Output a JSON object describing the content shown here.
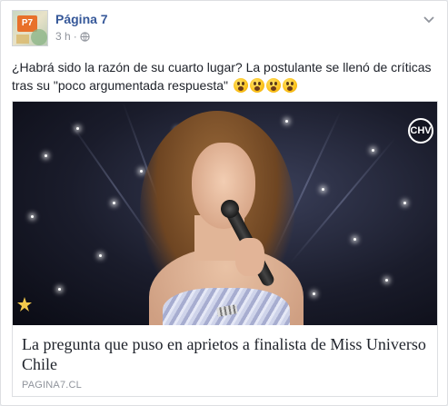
{
  "post": {
    "page_name": "Página 7",
    "avatar_text": "P7",
    "time": "3 h",
    "separator": "·",
    "text": "¿Habrá sido la razón de su cuarto lugar? La postulante se llenó de críticas tras su \"poco argumentada respuesta\"",
    "emoji_count": 4,
    "emoji_name": "astonished-face-emoji"
  },
  "link": {
    "headline": "La pregunta que puso en aprietos a finalista de Miss Universo Chile",
    "domain": "PAGINA7.CL",
    "image_logo": "CHV",
    "image_description_icons": [
      "chv-logo-icon",
      "miss-universo-logo-icon"
    ]
  },
  "icons": {
    "privacy": "globe-icon",
    "menu": "chevron-down-icon"
  },
  "colors": {
    "page_name": "#365899",
    "meta_text": "#90949c",
    "body_text": "#1d2129",
    "border": "#dddfe2",
    "avatar_badge": "#e8702a"
  }
}
